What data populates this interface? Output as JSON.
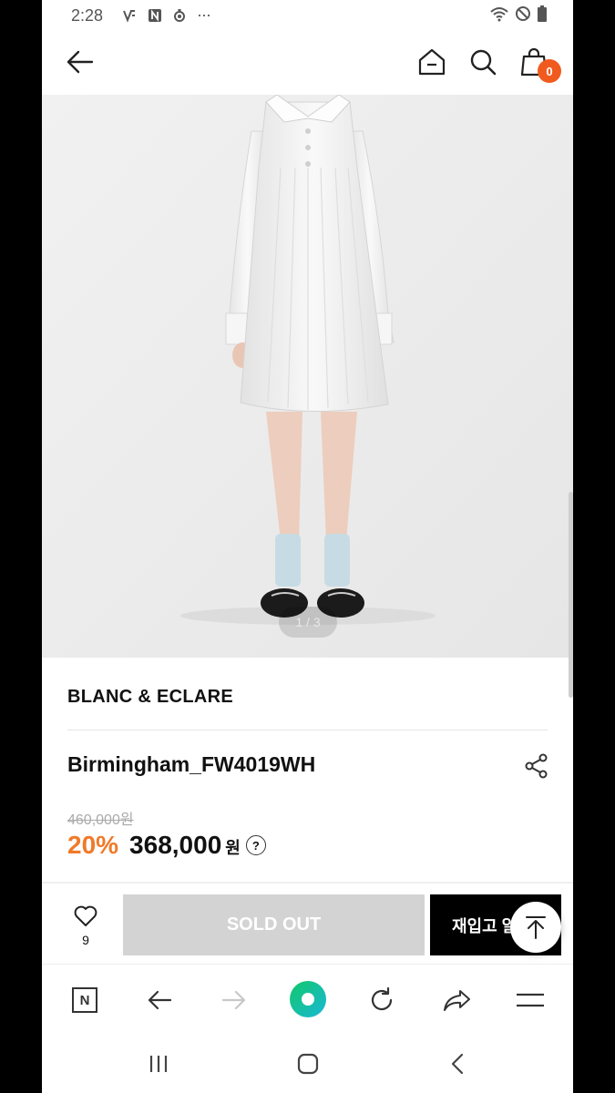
{
  "status_bar": {
    "time": "2:28",
    "icons": [
      "v-icon",
      "n-icon",
      "drop-icon",
      "more-dots-icon",
      "wifi-icon",
      "dnd-icon",
      "battery-icon"
    ],
    "more": "···"
  },
  "app_bar": {
    "cart_count": "0",
    "icons": [
      "back-arrow-icon",
      "home-icon",
      "search-icon",
      "cart-icon"
    ]
  },
  "gallery": {
    "pager": "1 / 3"
  },
  "product": {
    "brand": "BLANC & ECLARE",
    "name": "Birmingham_FW4019WH",
    "original_price": "460,000원",
    "discount": "20%",
    "price": "368,000",
    "currency": "원",
    "help": "?"
  },
  "actions": {
    "likes": "9",
    "sold_out": "SOLD OUT",
    "restock": "재입고 알"
  },
  "browser": {
    "n_label": "N"
  },
  "colors": {
    "discount": "#f07a2a",
    "badge": "#f15a1f",
    "soldout_bg": "#d3d3d3",
    "restock_bg": "#000000"
  }
}
